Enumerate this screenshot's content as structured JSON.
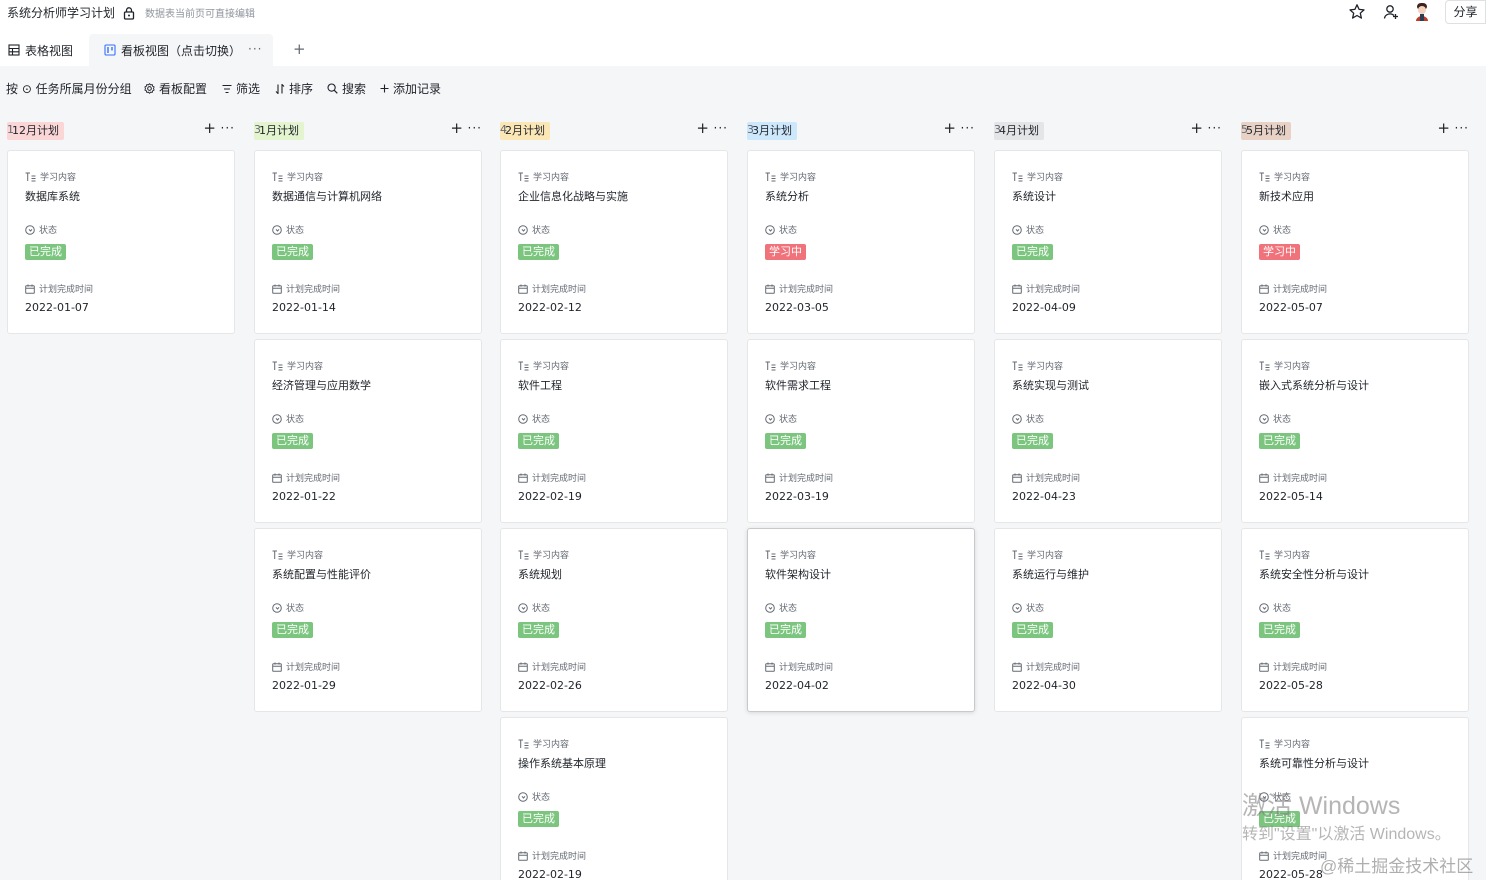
{
  "header": {
    "title": "系统分析师学习计划",
    "lock_hint": "数据表当前页可直接编辑",
    "share_label": "分享"
  },
  "tabs": [
    {
      "label": "表格视图",
      "icon": "grid-icon"
    },
    {
      "label": "看板视图（点击切换）",
      "icon": "kanban-icon"
    }
  ],
  "tab_more": "···",
  "tab_add": "+",
  "toolbar": {
    "group_by": "按 ⊙ 任务所属月份分组",
    "board_config": "看板配置",
    "filter": "筛选",
    "sort": "排序",
    "search": "搜索",
    "add_record": "添加记录"
  },
  "field_labels": {
    "content": "学习内容",
    "status": "状态",
    "date": "计划完成时间"
  },
  "status_colors": {
    "已完成": "#7bc57f",
    "学习中": "#f0727a"
  },
  "columns": [
    {
      "label": "12月计划",
      "count": "1",
      "color": "#fbd6d6",
      "cards": [
        {
          "title": "数据库系统",
          "status": "已完成",
          "date": "2022-01-07"
        }
      ]
    },
    {
      "label": "1月计划",
      "count": "3",
      "color": "#e3f4cf",
      "cards": [
        {
          "title": "数据通信与计算机网络",
          "status": "已完成",
          "date": "2022-01-14"
        },
        {
          "title": "经济管理与应用数学",
          "status": "已完成",
          "date": "2022-01-22"
        },
        {
          "title": "系统配置与性能评价",
          "status": "已完成",
          "date": "2022-01-29"
        }
      ]
    },
    {
      "label": "2月计划",
      "count": "4",
      "color": "#fbe6b6",
      "cards": [
        {
          "title": "企业信息化战略与实施",
          "status": "已完成",
          "date": "2022-02-12"
        },
        {
          "title": "软件工程",
          "status": "已完成",
          "date": "2022-02-19"
        },
        {
          "title": "系统规划",
          "status": "已完成",
          "date": "2022-02-26"
        },
        {
          "title": "操作系统基本原理",
          "status": "已完成",
          "date": "2022-02-19"
        }
      ]
    },
    {
      "label": "3月计划",
      "count": "3",
      "color": "#cde7fb",
      "cards": [
        {
          "title": "系统分析",
          "status": "学习中",
          "date": "2022-03-05"
        },
        {
          "title": "软件需求工程",
          "status": "已完成",
          "date": "2022-03-19"
        },
        {
          "title": "软件架构设计",
          "status": "已完成",
          "date": "2022-04-02"
        }
      ]
    },
    {
      "label": "4月计划",
      "count": "3",
      "color": "#e4e5e7",
      "cards": [
        {
          "title": "系统设计",
          "status": "已完成",
          "date": "2022-04-09"
        },
        {
          "title": "系统实现与测试",
          "status": "已完成",
          "date": "2022-04-23"
        },
        {
          "title": "系统运行与维护",
          "status": "已完成",
          "date": "2022-04-30"
        }
      ]
    },
    {
      "label": "5月计划",
      "count": "5",
      "color": "#e8d2c6",
      "cards": [
        {
          "title": "新技术应用",
          "status": "学习中",
          "date": "2022-05-07"
        },
        {
          "title": "嵌入式系统分析与设计",
          "status": "已完成",
          "date": "2022-05-14"
        },
        {
          "title": "系统安全性分析与设计",
          "status": "已完成",
          "date": "2022-05-28"
        },
        {
          "title": "系统可靠性分析与设计",
          "status": "已完成",
          "date": "2022-05-28"
        }
      ]
    }
  ],
  "watermark": {
    "line1": "激活 Windows",
    "line2": "转到\"设置\"以激活 Windows。",
    "line3": "@稀土掘金技术社区"
  }
}
